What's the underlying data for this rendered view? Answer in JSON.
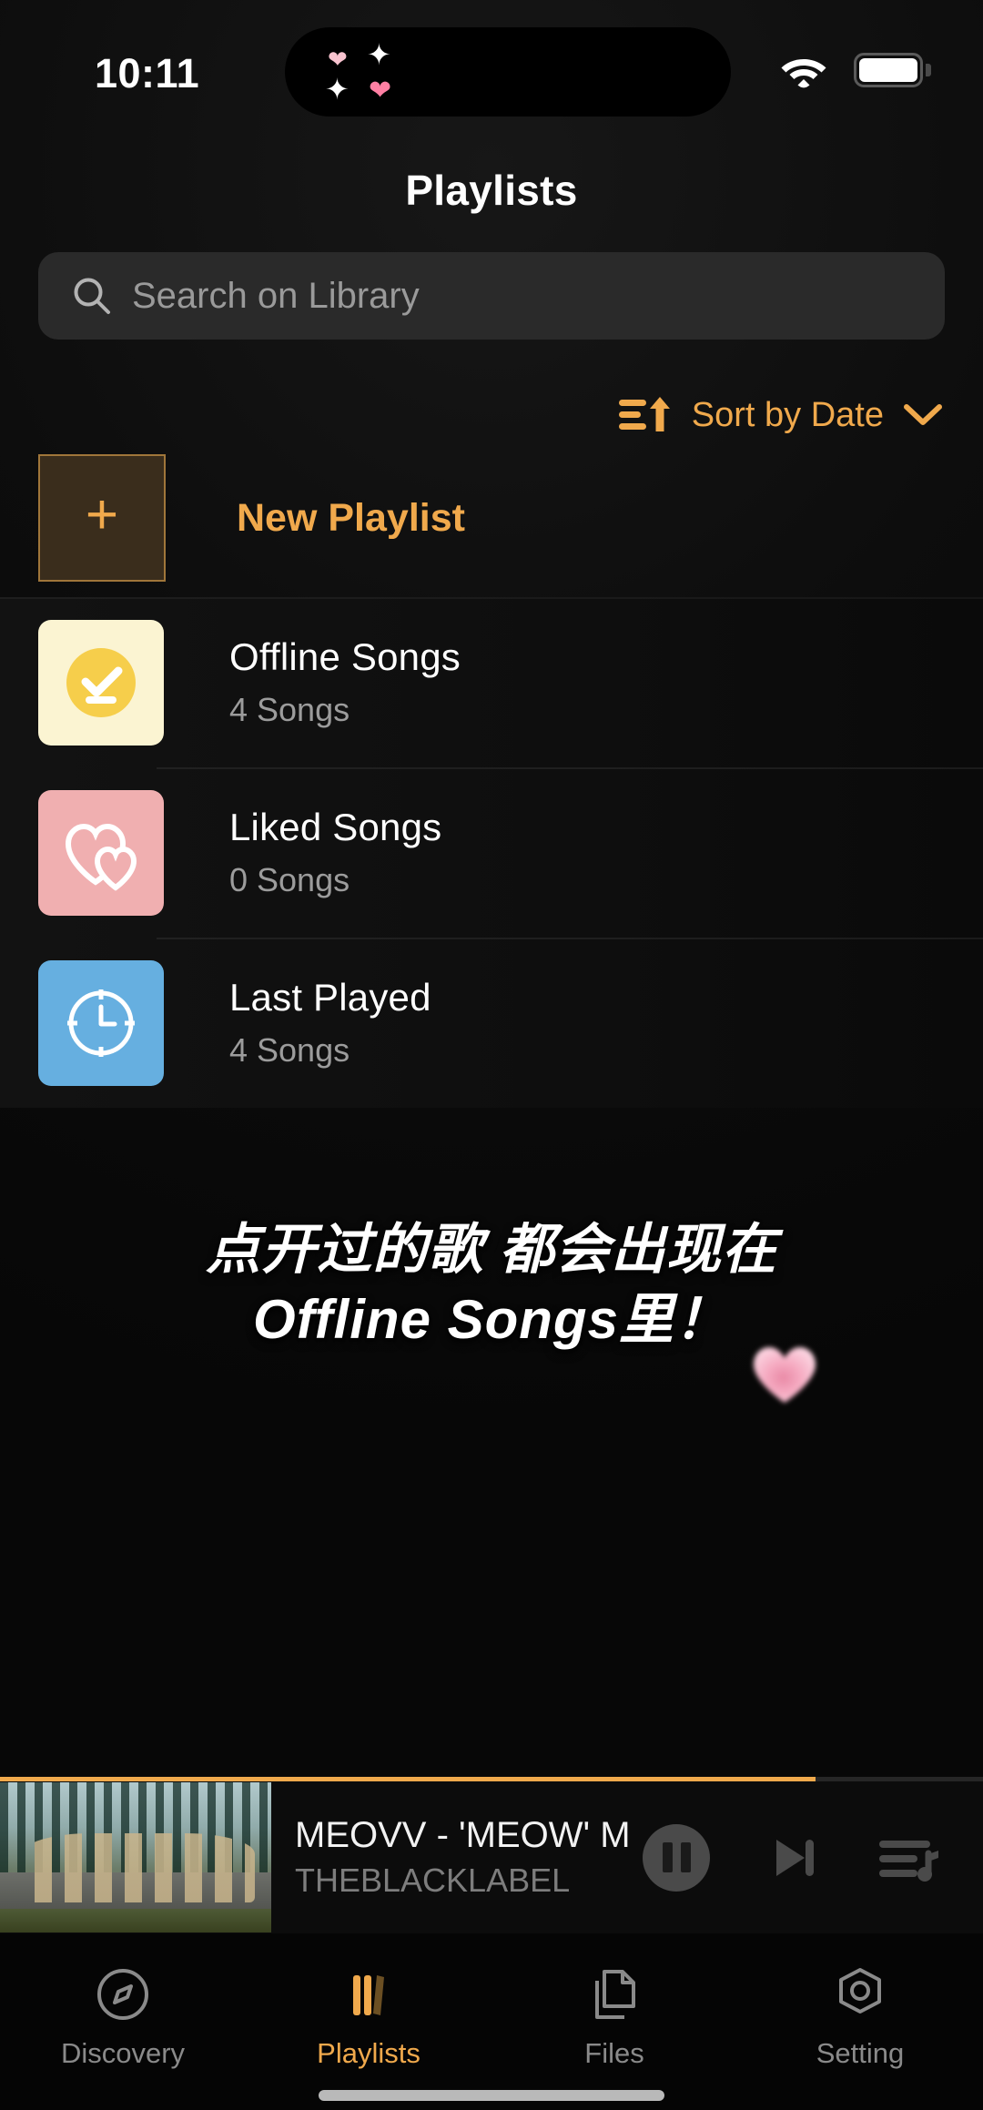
{
  "status_bar": {
    "time": "10:11",
    "wifi_icon": "wifi-icon",
    "battery_icon": "battery-icon",
    "island_decor": [
      "heart-small",
      "sparkle",
      "sparkle",
      "heart-pink"
    ]
  },
  "header": {
    "title": "Playlists"
  },
  "search": {
    "placeholder": "Search on Library",
    "value": "",
    "icon": "search-icon"
  },
  "sort": {
    "icon": "sort-ascending-icon",
    "label": "Sort by Date",
    "chevron": "chevron-down-icon"
  },
  "new_playlist": {
    "label": "New Playlist",
    "icon": "plus-icon"
  },
  "playlists": [
    {
      "name": "Offline Songs",
      "count": "4 Songs",
      "icon": "check-circle-icon",
      "tile_color": "#FBF4D2",
      "glyph_color": "#F6CE4B"
    },
    {
      "name": "Liked Songs",
      "count": "0 Songs",
      "icon": "double-heart-icon",
      "tile_color": "#F0AFB0",
      "glyph_color": "#FFFFFF"
    },
    {
      "name": "Last Played",
      "count": "4 Songs",
      "icon": "clock-icon",
      "tile_color": "#66AFE0",
      "glyph_color": "#FFFFFF"
    }
  ],
  "caption": {
    "line1": "点开过的歌  都会出现在",
    "line2": "Offline  Songs里！",
    "sticker": "pink-heart-sticker"
  },
  "mini_player": {
    "title": "MEOVV - 'MEOW' M",
    "artist": "THEBLACKLABEL",
    "progress_percent": 83,
    "progress_color": "#F0A94C",
    "pause_icon": "pause-icon",
    "next_icon": "next-track-icon",
    "queue_icon": "queue-list-icon",
    "artwork": "album-artwork"
  },
  "tabbar": {
    "items": [
      {
        "label": "Discovery",
        "icon": "compass-icon",
        "active": false
      },
      {
        "label": "Playlists",
        "icon": "playlists-icon",
        "active": true
      },
      {
        "label": "Files",
        "icon": "files-icon",
        "active": false
      },
      {
        "label": "Setting",
        "icon": "settings-icon",
        "active": false
      }
    ],
    "accent_color": "#F0A94C"
  }
}
